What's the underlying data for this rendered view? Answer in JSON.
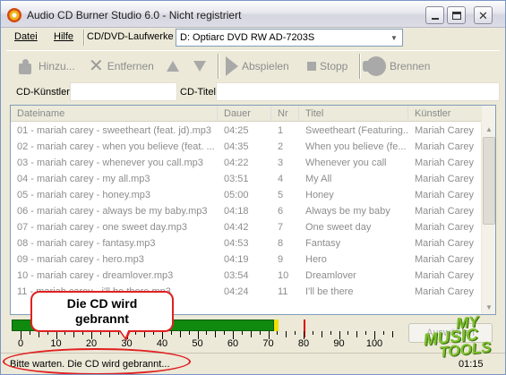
{
  "window": {
    "title": "Audio CD Burner Studio 6.0 - Nicht registriert"
  },
  "menu": {
    "file": "Datei",
    "help": "Hilfe",
    "drive_label": "CD/DVD-Laufwerke",
    "drive_value": "D: Optiarc DVD RW AD-7203S"
  },
  "toolbar": {
    "add": "Hinzu...",
    "remove": "Entfernen",
    "play": "Abspielen",
    "stop": "Stopp",
    "burn": "Brennen"
  },
  "fields": {
    "artist_label": "CD-Künstler",
    "artist_value": "",
    "title_label": "CD-Titel",
    "title_value": ""
  },
  "list": {
    "columns": [
      "Dateiname",
      "Dauer",
      "Nr",
      "Titel",
      "Künstler"
    ],
    "rows": [
      [
        "01 - mariah carey - sweetheart (feat. jd).mp3",
        "04:25",
        "1",
        "Sweetheart (Featuring...",
        "Mariah Carey"
      ],
      [
        "02 - mariah carey - when you believe (feat. ...",
        "04:35",
        "2",
        "When you believe (fe...",
        "Mariah Carey"
      ],
      [
        "03 - mariah carey - whenever you call.mp3",
        "04:22",
        "3",
        "Whenever you call",
        "Mariah Carey"
      ],
      [
        "04 - mariah carey - my all.mp3",
        "03:51",
        "4",
        "My All",
        "Mariah Carey"
      ],
      [
        "05 - mariah carey - honey.mp3",
        "05:00",
        "5",
        "Honey",
        "Mariah Carey"
      ],
      [
        "06 - mariah carey - always be my baby.mp3",
        "04:18",
        "6",
        "Always be my baby",
        "Mariah Carey"
      ],
      [
        "07 - mariah carey - one sweet day.mp3",
        "04:42",
        "7",
        "One sweet day",
        "Mariah Carey"
      ],
      [
        "08 - mariah carey - fantasy.mp3",
        "04:53",
        "8",
        "Fantasy",
        "Mariah Carey"
      ],
      [
        "09 - mariah carey - hero.mp3",
        "04:19",
        "9",
        "Hero",
        "Mariah Carey"
      ],
      [
        "10 - mariah carey - dreamlover.mp3",
        "03:54",
        "10",
        "Dreamlover",
        "Mariah Carey"
      ],
      [
        "11 - mariah carey - i'll be there.mp3",
        "04:24",
        "11",
        "I'll be there",
        "Mariah Carey"
      ]
    ]
  },
  "callout": {
    "line1": "Die CD wird",
    "line2": "gebrannt"
  },
  "meter": {
    "ticks": [
      "0",
      "10",
      "20",
      "30",
      "40",
      "50",
      "60",
      "70",
      "80",
      "90",
      "100"
    ],
    "fill_minutes": 73,
    "limit_minutes": 80,
    "select_button": "Auswählen"
  },
  "logo": {
    "line1": "MY",
    "line2": "MUSIC",
    "line3": "TOOLS"
  },
  "status": {
    "message": "Bitte warten. Die CD wird gebrannt...",
    "time": "01:15"
  },
  "colors": {
    "meter_fill": "#0f8a0f",
    "meter_warn": "#f2e000",
    "meter_limit": "#d80000",
    "annotation": "#e02020"
  }
}
